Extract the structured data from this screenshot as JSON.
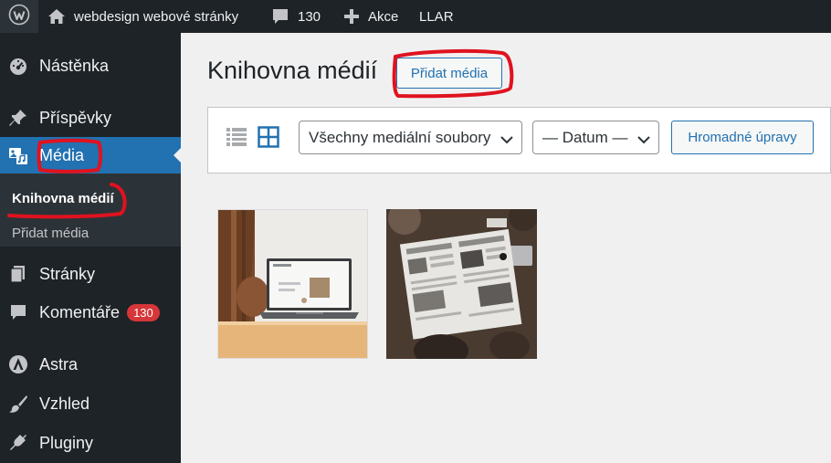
{
  "admin_bar": {
    "wp_logo_icon": "wordpress-icon",
    "site_icon": "home-icon",
    "site_name": "webdesign webové stránky",
    "comments_icon": "comment-bubble-icon",
    "comments_count": "130",
    "new_icon": "plus-icon",
    "new_label": "Akce",
    "plugin_label": "LLAR"
  },
  "sidebar": {
    "items": [
      {
        "label": "Nástěnka",
        "icon": "dashboard-icon"
      },
      {
        "label": "Příspěvky",
        "icon": "pin-icon"
      },
      {
        "label": "Média",
        "icon": "media-icon",
        "active": true
      },
      {
        "label": "Stránky",
        "icon": "pages-icon"
      },
      {
        "label": "Komentáře",
        "icon": "comment-icon",
        "badge": "130"
      },
      {
        "label": "Astra",
        "icon": "astra-icon"
      },
      {
        "label": "Vzhled",
        "icon": "brush-icon"
      },
      {
        "label": "Pluginy",
        "icon": "plugin-icon"
      }
    ],
    "submenu": [
      {
        "label": "Knihovna médií",
        "current": true
      },
      {
        "label": "Přidat média"
      }
    ]
  },
  "main": {
    "title": "Knihovna médií",
    "add_button": "Přidat média",
    "toolbar": {
      "type_filter": "Všechny mediální soubory",
      "date_filter": "— Datum —",
      "bulk_button": "Hromadné úpravy"
    },
    "media": [
      {
        "subject": "laptop on desk"
      },
      {
        "subject": "people reading newspapers"
      }
    ]
  },
  "colors": {
    "admin_dark": "#1d2327",
    "accent_blue": "#2271b1",
    "badge_red": "#d63638",
    "annotation_red": "#e0121f"
  }
}
